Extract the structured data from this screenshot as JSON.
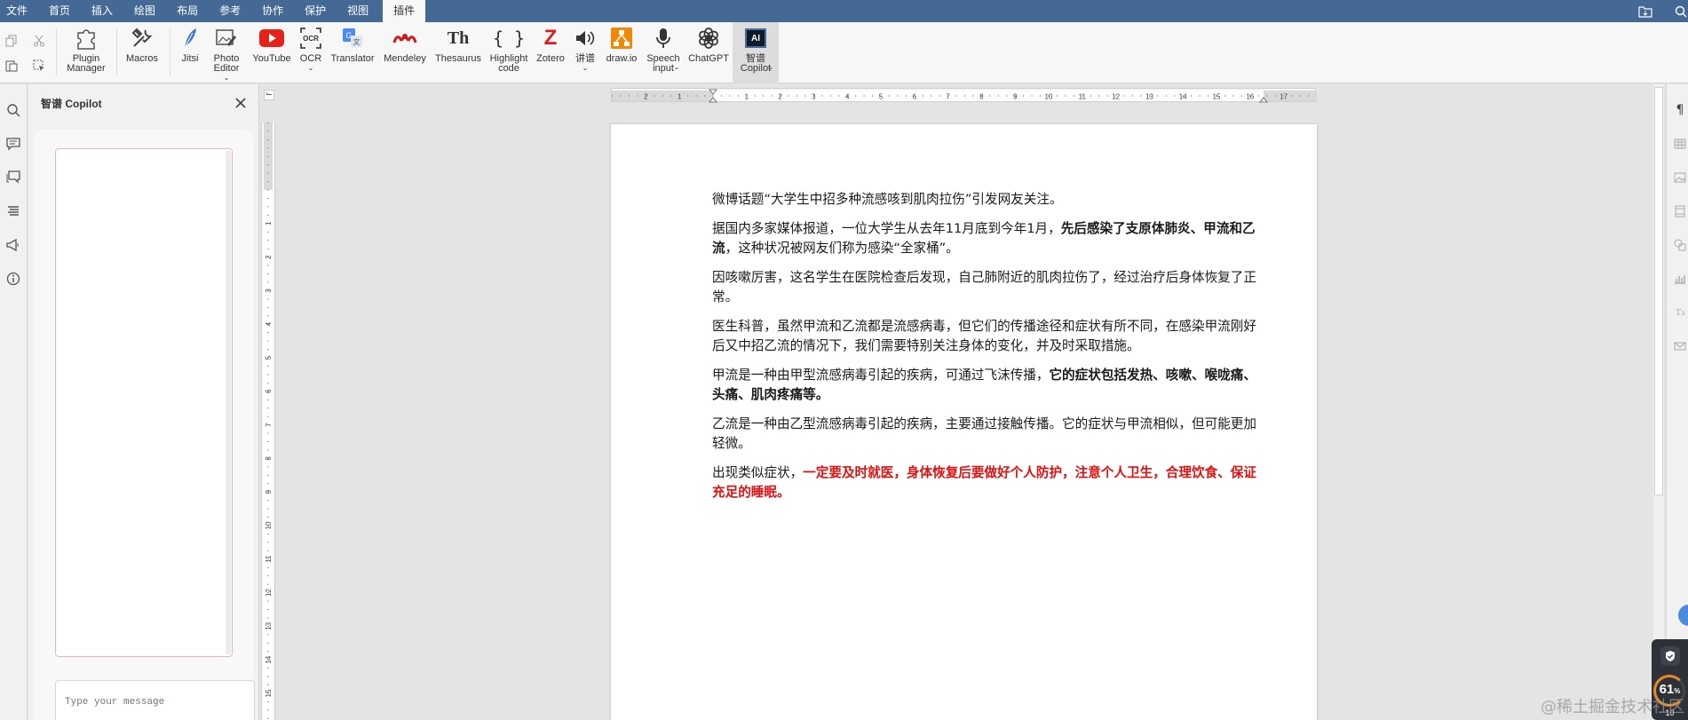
{
  "menu": {
    "tabs": [
      {
        "label": "文件"
      },
      {
        "label": "首页"
      },
      {
        "label": "插入"
      },
      {
        "label": "绘图"
      },
      {
        "label": "布局"
      },
      {
        "label": "参考"
      },
      {
        "label": "协作"
      },
      {
        "label": "保护"
      },
      {
        "label": "视图"
      },
      {
        "label": "插件"
      }
    ],
    "active_tab": "插件"
  },
  "toolbar": {
    "plugins": [
      {
        "label": "Plugin Manager",
        "icon": "puzzle-icon"
      },
      {
        "label": "Macros",
        "icon": "tools-icon"
      },
      {
        "label": "Jitsi",
        "icon": "feather-icon"
      },
      {
        "label": "Photo Editor",
        "icon": "photo-edit-icon"
      },
      {
        "label": "YouTube",
        "icon": "youtube-icon"
      },
      {
        "label": "OCR",
        "icon": "ocr-icon"
      },
      {
        "label": "Translator",
        "icon": "translate-icon"
      },
      {
        "label": "Mendeley",
        "icon": "mendeley-icon"
      },
      {
        "label": "Thesaurus",
        "icon": "thesaurus-icon",
        "glyph": "Th"
      },
      {
        "label": "Highlight code",
        "icon": "braces-icon",
        "glyph": "{ }"
      },
      {
        "label": "Zotero",
        "icon": "zotero-icon",
        "glyph": "Z"
      },
      {
        "label": "讲谱",
        "icon": "speaker-icon"
      },
      {
        "label": "draw.io",
        "icon": "drawio-icon"
      },
      {
        "label": "Speech input",
        "icon": "microphone-icon"
      },
      {
        "label": "ChatGPT",
        "icon": "chatgpt-icon"
      },
      {
        "label": "智谱 Copilot",
        "icon": "ai-icon",
        "glyph": "AI"
      }
    ]
  },
  "copilot": {
    "title": "智谱 Copilot",
    "input_placeholder": "Type your message"
  },
  "document": {
    "paragraphs": [
      {
        "text": "微博话题“大学生中招多种流感咳到肌肉拉伤”引发网友关注。"
      },
      {
        "pre": "据国内多家媒体报道，一位大学生从去年11月底到今年1月，",
        "bold": "先后感染了支原体肺炎、甲流和乙流",
        "post": "，这种状况被网友们称为感染“全家桶”。"
      },
      {
        "text": "因咳嗽厉害，这名学生在医院检查后发现，自己肺附近的肌肉拉伤了，经过治疗后身体恢复了正常。"
      },
      {
        "text": "医生科普，虽然甲流和乙流都是流感病毒，但它们的传播途径和症状有所不同，在感染甲流刚好后又中招乙流的情况下，我们需要特别关注身体的变化，并及时采取措施。"
      },
      {
        "pre": "甲流是一种由甲型流感病毒引起的疾病，可通过飞沫传播，",
        "bold": "它的症状包括发热、咳嗽、喉咙痛、头痛、肌肉疼痛等。"
      },
      {
        "text": "乙流是一种由乙型流感病毒引起的疾病，主要通过接触传播。它的症状与甲流相似，但可能更加轻微。"
      },
      {
        "pre": "出现类似症状，",
        "red": "一定要及时就医，身体恢复后要做好个人防护，注意个人卫生，合理饮食、保证充足的睡眠。"
      }
    ]
  },
  "ruler": {
    "labels": [
      "2",
      "1",
      "1",
      "2",
      "3",
      "4",
      "5",
      "6",
      "7",
      "8",
      "9",
      "10",
      "11",
      "12",
      "13",
      "14",
      "15",
      "16",
      "17"
    ]
  },
  "security_widget": {
    "score": "61",
    "unit": "%",
    "sub": "10"
  },
  "watermark": "@稀土掘金技术社区",
  "colors": {
    "menubar": "#446995",
    "red_text": "#e01010",
    "accent_blue": "#4b8bdb"
  }
}
